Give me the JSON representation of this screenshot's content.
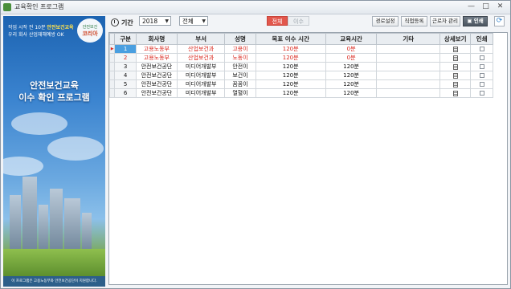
{
  "window": {
    "title": "교육확인 프로그램",
    "controls": [
      "—",
      "□",
      "✕"
    ]
  },
  "side_panel": {
    "tagline_prefix": "작업 시작 전 10분",
    "tagline_highlight": "안전보건교육",
    "tagline_line2": "우리 회사 산업재해예방 OK",
    "badge_small": "안전보건",
    "badge_big": "코리아",
    "headline_line1": "안전보건교육",
    "headline_line2": "이수 확인 프로그램",
    "footer": "이 프로그램은 고용노동부와 안전보건공단이 지원합니다."
  },
  "toolbar": {
    "period_label": "기간",
    "year_value": "2018",
    "scope_value": "전체",
    "tab_all": "전체",
    "tab_completed": "이수",
    "btn_path": "경로설정",
    "btn_direct": "직접등록",
    "btn_workers": "근로자 관리",
    "btn_print": "인쇄"
  },
  "table": {
    "columns": [
      "구분",
      "회사명",
      "부서",
      "성명",
      "목표 이수 시간",
      "교육시간",
      "기타",
      "상세보기",
      "인쇄"
    ],
    "rows": [
      {
        "no": "1",
        "company": "고용노동부",
        "dept": "산업보건과",
        "name": "고용이",
        "target": "120분",
        "hours": "0분",
        "etc": ""
      },
      {
        "no": "2",
        "company": "고용노동부",
        "dept": "산업보건과",
        "name": "노동이",
        "target": "120분",
        "hours": "0분",
        "etc": ""
      },
      {
        "no": "3",
        "company": "안전보건공단",
        "dept": "미디어개발부",
        "name": "안전이",
        "target": "120분",
        "hours": "120분",
        "etc": ""
      },
      {
        "no": "4",
        "company": "안전보건공단",
        "dept": "미디어개발부",
        "name": "보건이",
        "target": "120분",
        "hours": "120분",
        "etc": ""
      },
      {
        "no": "5",
        "company": "안전보건공단",
        "dept": "미디어개발부",
        "name": "꼼꼼이",
        "target": "120분",
        "hours": "120분",
        "etc": ""
      },
      {
        "no": "6",
        "company": "안전보건공단",
        "dept": "미디어개발부",
        "name": "열혈이",
        "target": "120분",
        "hours": "120분",
        "etc": ""
      }
    ]
  }
}
